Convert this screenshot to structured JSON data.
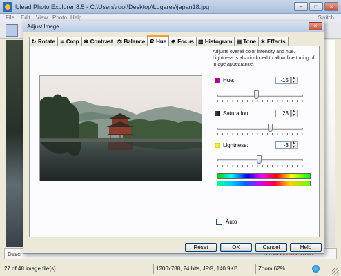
{
  "app": {
    "title": "Ulead Photo Explorer 8.5 - C:\\Users\\root\\Desktop\\Lugares\\japan18.jpg",
    "window_controls": [
      "–",
      "□",
      "×"
    ],
    "menu": [
      "File",
      "Edit",
      "View",
      "Photo",
      "Help"
    ],
    "switch_label": "Switch",
    "description_label": "Descr"
  },
  "dialog": {
    "title": "Adjust Image",
    "close_glyph": "×",
    "tabs": [
      {
        "label": "Rotate",
        "icon": "rotate-icon",
        "glyph": "↻"
      },
      {
        "label": "Crop",
        "icon": "crop-icon",
        "glyph": "⌗"
      },
      {
        "label": "Contrast",
        "icon": "contrast-icon",
        "glyph": "✱"
      },
      {
        "label": "Balance",
        "icon": "balance-icon",
        "glyph": "⚖"
      },
      {
        "label": "Hue",
        "icon": "hue-icon",
        "glyph": "✿",
        "active": true
      },
      {
        "label": "Focus",
        "icon": "focus-icon",
        "glyph": "⊕"
      },
      {
        "label": "Histogram",
        "icon": "histogram-icon",
        "glyph": "▥"
      },
      {
        "label": "Tone",
        "icon": "tone-icon",
        "glyph": "▤"
      },
      {
        "label": "Effects",
        "icon": "effects-icon",
        "glyph": "✶"
      }
    ],
    "description": "Adjusts overall color intensity and hue. Lightness is also included to allow fine tuning of image appearance:",
    "sliders": {
      "hue": {
        "label": "Hue:",
        "value": "-15",
        "min": -180,
        "max": 180,
        "level": -15
      },
      "saturation": {
        "label": "Saturation:",
        "value": "23",
        "min": -100,
        "max": 100,
        "level": 23
      },
      "lightness": {
        "label": "Lightness:",
        "value": "-3",
        "min": -100,
        "max": 100,
        "level": -3
      }
    },
    "auto_label": "Auto",
    "buttons": {
      "reset": "Reset",
      "ok": "OK",
      "cancel": "Cancel",
      "help": "Help"
    },
    "colors": {
      "accent_tab": "#f0a030",
      "dialog_bg": "#ece9d8"
    }
  },
  "status": {
    "count": "27 of 48 image file(s)",
    "info": "1206x788, 24 bits, JPG, 140.9KB",
    "zoom": "Zoom 62%"
  },
  "watermark": {
    "prefix": "mala",
    "accent": "vida",
    "suffix": ".com"
  }
}
